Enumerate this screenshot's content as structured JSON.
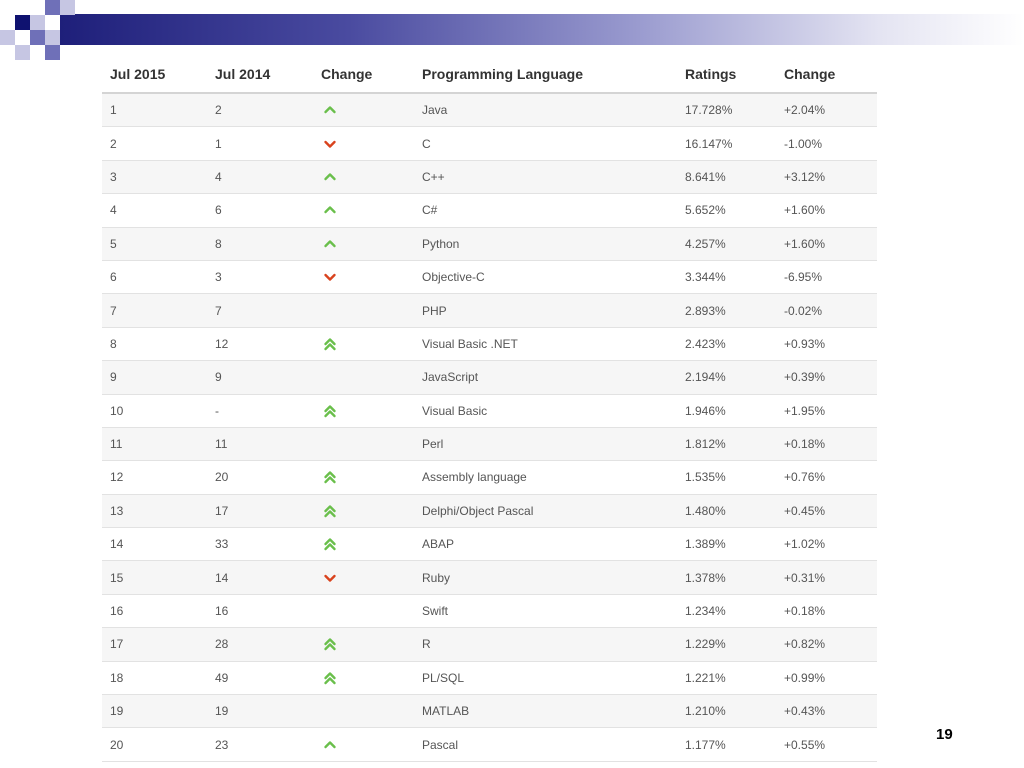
{
  "table": {
    "headers": [
      "Jul 2015",
      "Jul 2014",
      "Change",
      "Programming Language",
      "Ratings",
      "Change"
    ],
    "rows": [
      {
        "rank": "1",
        "prev": "2",
        "trend": "up",
        "language": "Java",
        "rating": "17.728%",
        "change": "+2.04%"
      },
      {
        "rank": "2",
        "prev": "1",
        "trend": "down",
        "language": "C",
        "rating": "16.147%",
        "change": "-1.00%"
      },
      {
        "rank": "3",
        "prev": "4",
        "trend": "up",
        "language": "C++",
        "rating": "8.641%",
        "change": "+3.12%"
      },
      {
        "rank": "4",
        "prev": "6",
        "trend": "up",
        "language": "C#",
        "rating": "5.652%",
        "change": "+1.60%"
      },
      {
        "rank": "5",
        "prev": "8",
        "trend": "up",
        "language": "Python",
        "rating": "4.257%",
        "change": "+1.60%"
      },
      {
        "rank": "6",
        "prev": "3",
        "trend": "down",
        "language": "Objective-C",
        "rating": "3.344%",
        "change": "-6.95%"
      },
      {
        "rank": "7",
        "prev": "7",
        "trend": "none",
        "language": "PHP",
        "rating": "2.893%",
        "change": "-0.02%"
      },
      {
        "rank": "8",
        "prev": "12",
        "trend": "double-up",
        "language": "Visual Basic .NET",
        "rating": "2.423%",
        "change": "+0.93%"
      },
      {
        "rank": "9",
        "prev": "9",
        "trend": "none",
        "language": "JavaScript",
        "rating": "2.194%",
        "change": "+0.39%"
      },
      {
        "rank": "10",
        "prev": "-",
        "trend": "double-up",
        "language": "Visual Basic",
        "rating": "1.946%",
        "change": "+1.95%"
      },
      {
        "rank": "11",
        "prev": "11",
        "trend": "none",
        "language": "Perl",
        "rating": "1.812%",
        "change": "+0.18%"
      },
      {
        "rank": "12",
        "prev": "20",
        "trend": "double-up",
        "language": "Assembly language",
        "rating": "1.535%",
        "change": "+0.76%"
      },
      {
        "rank": "13",
        "prev": "17",
        "trend": "double-up",
        "language": "Delphi/Object Pascal",
        "rating": "1.480%",
        "change": "+0.45%"
      },
      {
        "rank": "14",
        "prev": "33",
        "trend": "double-up",
        "language": "ABAP",
        "rating": "1.389%",
        "change": "+1.02%"
      },
      {
        "rank": "15",
        "prev": "14",
        "trend": "down",
        "language": "Ruby",
        "rating": "1.378%",
        "change": "+0.31%"
      },
      {
        "rank": "16",
        "prev": "16",
        "trend": "none",
        "language": "Swift",
        "rating": "1.234%",
        "change": "+0.18%"
      },
      {
        "rank": "17",
        "prev": "28",
        "trend": "double-up",
        "language": "R",
        "rating": "1.229%",
        "change": "+0.82%"
      },
      {
        "rank": "18",
        "prev": "49",
        "trend": "double-up",
        "language": "PL/SQL",
        "rating": "1.221%",
        "change": "+0.99%"
      },
      {
        "rank": "19",
        "prev": "19",
        "trend": "none",
        "language": "MATLAB",
        "rating": "1.210%",
        "change": "+0.43%"
      },
      {
        "rank": "20",
        "prev": "23",
        "trend": "up",
        "language": "Pascal",
        "rating": "1.177%",
        "change": "+0.55%"
      }
    ]
  },
  "icons": {
    "up": "chevron-up-icon",
    "double-up": "double-chevron-up-icon",
    "down": "chevron-down-icon"
  },
  "colors": {
    "up": "#6abf4b",
    "down": "#d9431e",
    "header_dark": "#1e1f7a"
  },
  "slide": {
    "page_number": "19"
  }
}
